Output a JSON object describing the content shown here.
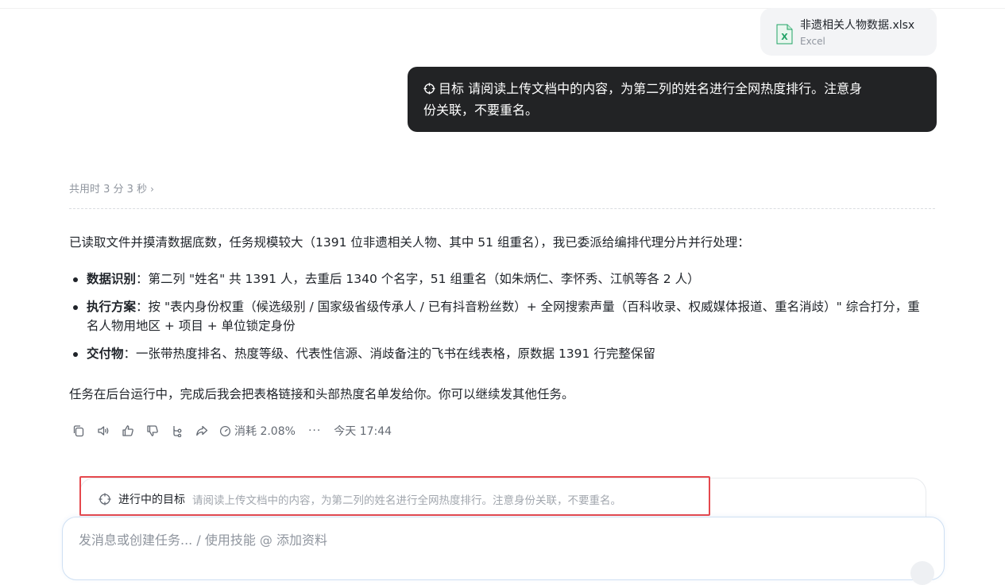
{
  "attachment": {
    "file_name": "非遗相关人物数据.xlsx",
    "file_type": "Excel",
    "icon": "excel-file-icon",
    "accent": "#21a366"
  },
  "user_message": {
    "prefix": "目标",
    "text": "请阅读上传文档中的内容，为第二列的姓名进行全网热度排行。注意身份关联，不要重名。",
    "line1": "目标 请阅读上传文档中的内容，为第二列的姓名进行全网热度排行。注意身",
    "line2": "份关联，不要重名。"
  },
  "response": {
    "elapsed": "共用时 3 分 3 秒",
    "intro": "已读取文件并摸清数据底数，任务规模较大（1391 位非遗相关人物、其中 51 组重名），我已委派给编排代理分片并行处理：",
    "bullets": [
      {
        "title": "数据识别",
        "text": "：第二列 \"姓名\" 共 1391 人，去重后 1340 个名字，51 组重名（如朱炳仁、李怀秀、江帆等各 2 人）"
      },
      {
        "title": "执行方案",
        "text": "：按 \"表内身份权重（候选级别 / 国家级省级传承人 / 已有抖音粉丝数）+ 全网搜索声量（百科收录、权威媒体报道、重名消歧）\" 综合打分，重名人物用地区 + 项目 + 单位锁定身份"
      },
      {
        "title": "交付物",
        "text": "：一张带热度排名、热度等级、代表性信源、消歧备注的飞书在线表格，原数据 1391 行完整保留"
      }
    ],
    "closing": "任务在后台运行中，完成后我会把表格链接和头部热度名单发给你。你可以继续发其他任务。"
  },
  "actions": {
    "consume": "消耗 2.08%",
    "more": "···",
    "time": "今天 17:44",
    "icons": [
      "copy-icon",
      "speaker-icon",
      "thumbs-up-icon",
      "thumbs-down-icon",
      "branch-icon",
      "share-icon"
    ]
  },
  "goal_bar": {
    "label": "进行中的目标",
    "text": "请阅读上传文档中的内容，为第二列的姓名进行全网热度排行。注意身份关联，不要重名。",
    "highlight_color": "#e5484d"
  },
  "composer": {
    "placeholder": "发消息或创建任务... / 使用技能 @ 添加资料"
  }
}
